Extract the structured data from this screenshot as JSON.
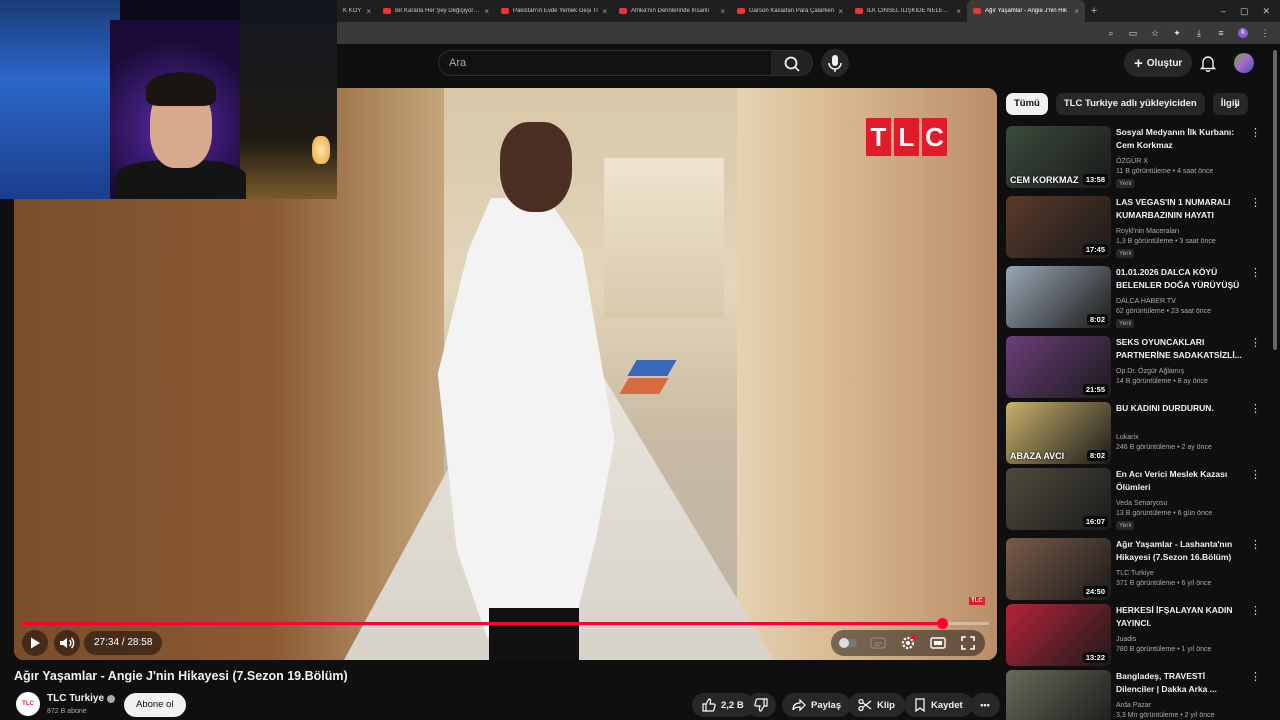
{
  "browser": {
    "tabs": [
      {
        "title": "K KÖY"
      },
      {
        "title": "Bir Kararla Her Şey Değişiyor: Ob"
      },
      {
        "title": "Pakistan'ın Evde Yemek Geşi Tr"
      },
      {
        "title": "Afrika'nın Derinlerinde İnsanlı"
      },
      {
        "title": "Garson Kasadan Para Çalarken"
      },
      {
        "title": "İLK CİNSEL İLİŞKİDE NELER YAP"
      },
      {
        "title": "Ağır Yaşamlar - Angie J'nin Hik"
      }
    ],
    "new_tab": "+",
    "profile_letter": "k"
  },
  "header": {
    "search_placeholder": "Ara",
    "create_label": "Oluştur"
  },
  "player": {
    "time": "27:34 / 28:58",
    "progress_fraction": 0.951,
    "brand_logo": "TLC",
    "brand_small": "TLC"
  },
  "video": {
    "title": "Ağır Yaşamlar - Angie J'nin Hikayesi (7.Sezon 19.Bölüm)",
    "channel": "TLC Turkiye",
    "channel_avatar_text": "TLC",
    "subscribers": "872 B abone",
    "subscribe_label": "Abone ol",
    "likes": "2,2 B",
    "share_label": "Paylaş",
    "clip_label": "Klip",
    "save_label": "Kaydet",
    "more_label": "•••"
  },
  "sidebar": {
    "chips": [
      "Tümü",
      "TLC Turkiye adlı yükleyiciden",
      "İlgili"
    ],
    "recommendations": [
      {
        "title": "Sosyal Medyanın İlk Kurbanı: Cem Korkmaz",
        "channel": "ÖZGÜR X",
        "meta": "11 B görüntüleme • 4 saat önce",
        "badge": "Yeni",
        "duration": "13:58",
        "thumb_caption": "CEM KORKMAZ",
        "color": "#3a4b3c"
      },
      {
        "title": "LAS VEGAS'IN 1 NUMARALI KUMARBAZININ HAYATI",
        "channel": "Roykl'nin Maceraları",
        "meta": "1,3 B görüntüleme • 3 saat önce",
        "badge": "Yeni",
        "duration": "17:45",
        "thumb_caption": "",
        "color": "#5a3a2a"
      },
      {
        "title": "01.01.2026 DALCA KÖYÜ BELENLER DOĞA YÜRÜYÜŞÜ",
        "channel": "DALCA HABER TV",
        "meta": "62 görüntüleme • 23 saat önce",
        "badge": "Yeni",
        "duration": "8:02",
        "thumb_caption": "",
        "color": "#9aa7b3"
      },
      {
        "title": "SEKS OYUNCAKLARI PARTNERİNE SADAKATSİZLİ...",
        "channel": "Op.Dr. Özgür Ağlamış",
        "meta": "14 B görüntüleme • 8 ay önce",
        "badge": "",
        "duration": "21:55",
        "thumb_caption": "",
        "color": "#6b3f7a"
      },
      {
        "title": "BU KADINI DURDURUN.",
        "channel": "Lukarix",
        "meta": "246 B görüntüleme • 2 ay önce",
        "badge": "",
        "duration": "8:02",
        "thumb_caption": "ABAZA AVCI",
        "color": "#c8b26a"
      },
      {
        "title": "En Acı Verici Meslek Kazası Ölümleri",
        "channel": "Veda Senaryosu",
        "meta": "13 B görüntüleme • 6 gün önce",
        "badge": "Yeni",
        "duration": "16:07",
        "thumb_caption": "",
        "color": "#4e4a3c"
      },
      {
        "title": "Ağır Yaşamlar - Lashanta'nın Hikayesi (7.Sezon 16.Bölüm)",
        "channel": "TLC Turkiye",
        "meta": "371 B görüntüleme • 6 yıl önce",
        "badge": "",
        "duration": "24:50",
        "thumb_caption": "",
        "color": "#7a5c4a"
      },
      {
        "title": "HERKESİ İFŞALAYAN KADIN YAYINCI.",
        "channel": "Juadis",
        "meta": "780 B görüntüleme • 1 yıl önce",
        "badge": "",
        "duration": "13:22",
        "thumb_caption": "",
        "color": "#b7233a"
      },
      {
        "title": "Bangladeş, TRAVESTİ Dilenciler | Dakka Arka ...",
        "channel": "Arda Pazar",
        "meta": "3,3 Mn görüntüleme • 2 yıl önce",
        "badge": "",
        "duration": "",
        "thumb_caption": "",
        "color": "#6a6a5a"
      }
    ]
  },
  "colors": {
    "accent_red": "#ff0033",
    "tlc_red": "#e01b2c",
    "background": "#0f0f0f"
  }
}
